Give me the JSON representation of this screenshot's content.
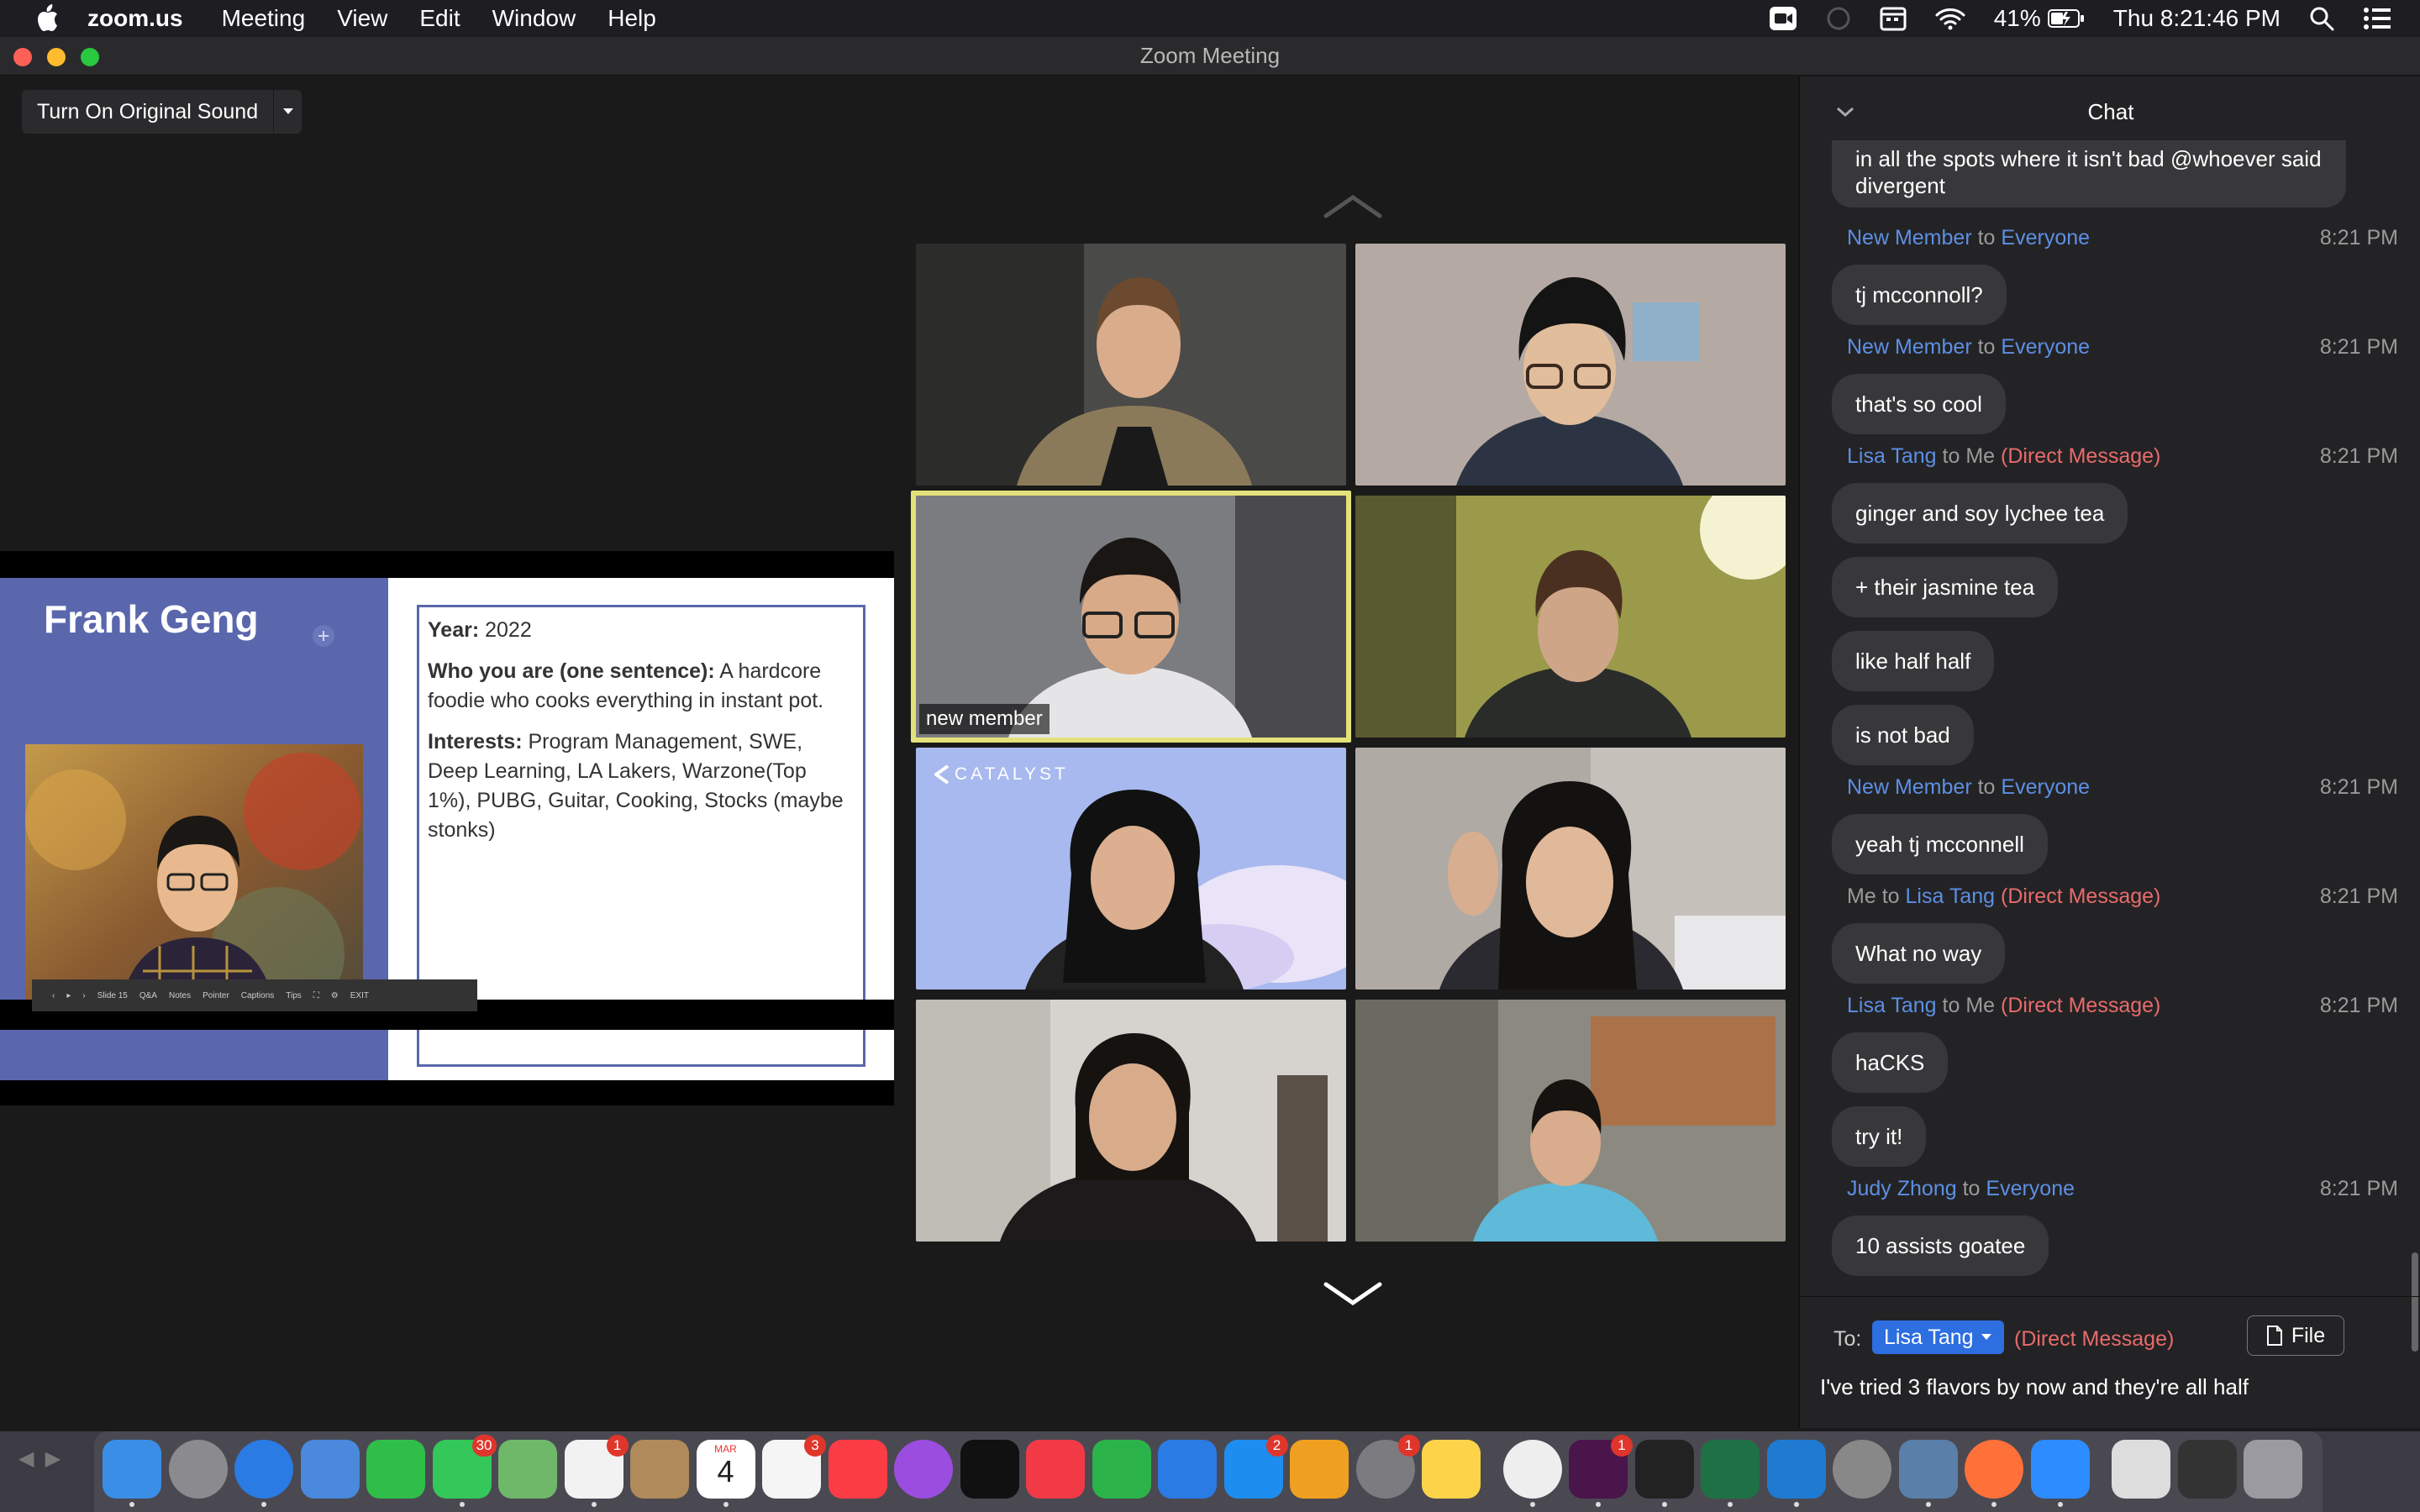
{
  "menubar": {
    "app_name": "zoom.us",
    "menus": [
      "Meeting",
      "View",
      "Edit",
      "Window",
      "Help"
    ],
    "battery": "41%",
    "clock": "Thu 8:21:46 PM"
  },
  "window": {
    "title": "Zoom Meeting"
  },
  "toolbar": {
    "original_sound_label": "Turn On Original Sound"
  },
  "slide": {
    "name": "Frank Geng",
    "year_label": "Year:",
    "year_value": "2022",
    "who_label": "Who you are (one sentence):",
    "who_value": "A hardcore foodie who cooks everything in instant pot.",
    "interests_label": "Interests:",
    "interests_value": "Program Management, SWE, Deep Learning, LA Lakers, Warzone(Top 1%), PUBG, Guitar, Cooking, Stocks (maybe stonks)",
    "toolbar_slide": "Slide 15",
    "toolbar_items": [
      "Q&A",
      "Notes",
      "Pointer",
      "Captions",
      "Tips",
      "EXIT"
    ]
  },
  "video_grid": {
    "active_label": "new member",
    "catalyst_text": "CATALYST"
  },
  "chat": {
    "title": "Chat",
    "partial_message": "in all the spots where it isn't bad @whoever said divergent",
    "to_word": "to",
    "dm_tag": "(Direct Message)",
    "messages": [
      {
        "from": "New Member",
        "to": "Everyone",
        "time": "8:21 PM",
        "texts": [
          "tj mcconnoll?"
        ]
      },
      {
        "from": "New Member",
        "to": "Everyone",
        "time": "8:21 PM",
        "texts": [
          "that's so cool"
        ]
      },
      {
        "from": "Lisa Tang",
        "to": "Me",
        "time": "8:21 PM",
        "texts": [
          "ginger and soy lychee tea",
          "+ their jasmine tea",
          "like half half",
          "is not bad"
        ]
      },
      {
        "from": "New Member",
        "to": "Everyone",
        "time": "8:21 PM",
        "texts": [
          "yeah tj mcconnell"
        ]
      },
      {
        "from": "Me",
        "to": "Lisa Tang",
        "time": "8:21 PM",
        "texts": [
          "What no way"
        ]
      },
      {
        "from": "Lisa Tang",
        "to": "Me",
        "time": "8:21 PM",
        "texts": [
          "haCKS",
          "try it!"
        ]
      },
      {
        "from": "Judy Zhong",
        "to": "Everyone",
        "time": "8:21 PM",
        "texts": [
          "10 assists goatee"
        ]
      }
    ],
    "composer": {
      "to_label": "To:",
      "recipient": "Lisa Tang",
      "dm_tag": "(Direct Message)",
      "file_label": "File",
      "draft": "I've tried 3 flavors by now and they're all half"
    }
  },
  "dock": {
    "icons": [
      "finder-icon",
      "launchpad-icon",
      "safari-icon",
      "mail-icon",
      "facetime-icon",
      "messages-icon",
      "maps-icon",
      "photos-icon",
      "contacts-icon",
      "calendar-icon",
      "reminders-icon",
      "music-icon",
      "podcasts-icon",
      "appletv-icon",
      "news-icon",
      "numbers-icon",
      "keynote-icon",
      "appstore-icon",
      "pages-icon",
      "systemprefs-icon",
      "notes-icon",
      "chrome-icon",
      "slack-icon",
      "terminal-icon",
      "excel-icon",
      "vscode-icon",
      "texshop-icon",
      "preview-icon",
      "firefox-icon",
      "zoom-icon",
      "documents-icon",
      "screenshot-icon",
      "trash-icon"
    ],
    "badges": {
      "messages": "30",
      "photos": "1",
      "reminders": "3",
      "appstore": "2",
      "systemprefs": "1",
      "slack": "1"
    },
    "calendar_month": "MAR",
    "calendar_day": "4"
  }
}
